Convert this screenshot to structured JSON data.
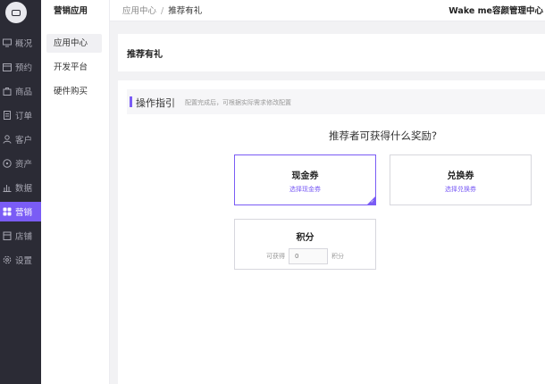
{
  "sidebar": {
    "items": [
      {
        "label": "概况",
        "icon": "monitor-icon"
      },
      {
        "label": "预约",
        "icon": "calendar-icon"
      },
      {
        "label": "商品",
        "icon": "bag-icon"
      },
      {
        "label": "订单",
        "icon": "document-icon"
      },
      {
        "label": "客户",
        "icon": "user-icon"
      },
      {
        "label": "资产",
        "icon": "coin-icon"
      },
      {
        "label": "数据",
        "icon": "bar-chart-icon"
      },
      {
        "label": "营销",
        "icon": "grid-icon",
        "active": true
      },
      {
        "label": "店铺",
        "icon": "store-icon"
      },
      {
        "label": "设置",
        "icon": "gear-icon"
      }
    ]
  },
  "submenu": {
    "title": "营销应用",
    "items": [
      {
        "label": "应用中心",
        "active": true
      },
      {
        "label": "开发平台"
      },
      {
        "label": "硬件购买"
      }
    ]
  },
  "topbar": {
    "breadcrumb_parent": "应用中心",
    "breadcrumb_separator": "/",
    "breadcrumb_current": "推荐有礼",
    "store_name": "Wake me容颜管理中心"
  },
  "page": {
    "title": "推荐有礼"
  },
  "guide": {
    "title": "操作指引",
    "tip": "配置完成后，可根据实际需求修改配置"
  },
  "reward": {
    "question": "推荐者可获得什么奖励?",
    "options": {
      "cash": {
        "name": "现金券",
        "link": "选择现金券",
        "selected": true
      },
      "exchange": {
        "name": "兑换券",
        "link": "选择兑换券"
      },
      "points": {
        "name": "积分",
        "prefix": "可获得",
        "placeholder": "0",
        "suffix": "积分"
      }
    }
  },
  "colors": {
    "accent": "#7a5cf5",
    "sidebar_bg": "#2b2b35"
  }
}
